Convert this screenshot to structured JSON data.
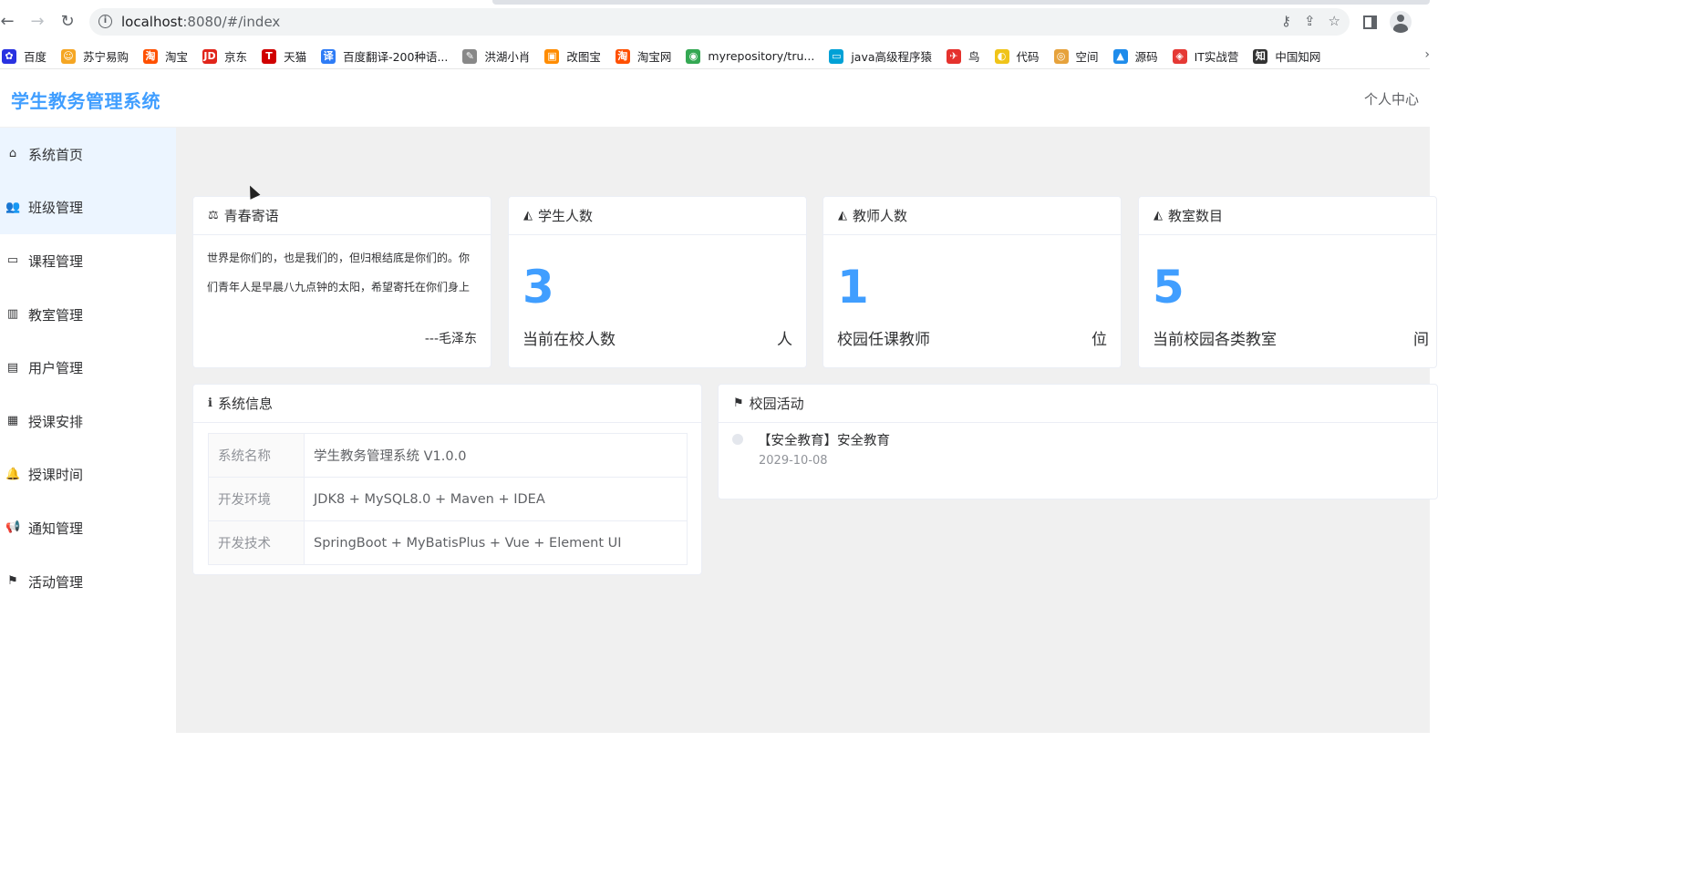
{
  "browser": {
    "url_host": "localhost",
    "url_path": ":8080/#/index",
    "bookmarks": [
      {
        "label": "百度",
        "icon": "baidu-icon",
        "color": "#2932e1",
        "glyph": "✿"
      },
      {
        "label": "苏宁易购",
        "icon": "suning-icon",
        "color": "#f5a623",
        "glyph": "☺"
      },
      {
        "label": "淘宝",
        "icon": "taobao-icon",
        "color": "#ff5000",
        "glyph": "淘"
      },
      {
        "label": "京东",
        "icon": "jd-icon",
        "color": "#e1251b",
        "glyph": "JD"
      },
      {
        "label": "天猫",
        "icon": "tmall-icon",
        "color": "#d00000",
        "glyph": "T"
      },
      {
        "label": "百度翻译-200种语...",
        "icon": "translate-icon",
        "color": "#2e7cf6",
        "glyph": "译"
      },
      {
        "label": "洪湖小肖",
        "icon": "hhxx-icon",
        "color": "#888888",
        "glyph": "✎"
      },
      {
        "label": "改图宝",
        "icon": "gaitubao-icon",
        "color": "#ff8c00",
        "glyph": "▣"
      },
      {
        "label": "淘宝网",
        "icon": "taobaowang-icon",
        "color": "#ff5000",
        "glyph": "淘"
      },
      {
        "label": "myrepository/tru...",
        "icon": "chrome-icon",
        "color": "#34a853",
        "glyph": "◉"
      },
      {
        "label": "java高级程序猿",
        "icon": "bilibili-icon",
        "color": "#00a1d6",
        "glyph": "▭"
      },
      {
        "label": "鸟",
        "icon": "bird-icon",
        "color": "#e5322d",
        "glyph": "✈"
      },
      {
        "label": "代码",
        "icon": "code-icon",
        "color": "#f0c419",
        "glyph": "◐"
      },
      {
        "label": "空间",
        "icon": "qzone-icon",
        "color": "#e6a23c",
        "glyph": "◎"
      },
      {
        "label": "源码",
        "icon": "yuanma-icon",
        "color": "#1f8ceb",
        "glyph": "▲"
      },
      {
        "label": "IT实战营",
        "icon": "it-icon",
        "color": "#e53935",
        "glyph": "◈"
      },
      {
        "label": "中国知网",
        "icon": "cnki-icon",
        "color": "#333333",
        "glyph": "知"
      }
    ]
  },
  "header": {
    "title": "学生教务管理系统",
    "personal": "个人中心"
  },
  "sidebar": {
    "items": [
      {
        "label": "系统首页",
        "icon": "home-icon",
        "glyph": "⌂"
      },
      {
        "label": "班级管理",
        "icon": "users-icon",
        "glyph": "👥"
      },
      {
        "label": "课程管理",
        "icon": "calendar-blank-icon",
        "glyph": "▭"
      },
      {
        "label": "教室管理",
        "icon": "building-icon",
        "glyph": "▥"
      },
      {
        "label": "用户管理",
        "icon": "id-card-icon",
        "glyph": "▤"
      },
      {
        "label": "授课安排",
        "icon": "calendar-icon",
        "glyph": "▦"
      },
      {
        "label": "授课时间",
        "icon": "bell-icon",
        "glyph": "🔔"
      },
      {
        "label": "通知管理",
        "icon": "bullhorn-icon",
        "glyph": "📢"
      },
      {
        "label": "活动管理",
        "icon": "flag-icon",
        "glyph": "⚑"
      }
    ]
  },
  "quote_card": {
    "title": "青春寄语",
    "icon": "balance-scale-icon",
    "text": "世界是你们的，也是我们的，但归根结底是你们的。你们青年人是早晨八九点钟的太阳，希望寄托在你们身上",
    "author": "---毛泽东"
  },
  "stats": [
    {
      "title": "学生人数",
      "icon": "area-chart-icon",
      "value": "3",
      "desc": "当前在校人数",
      "unit": "人"
    },
    {
      "title": "教师人数",
      "icon": "area-chart-icon",
      "value": "1",
      "desc": "校园任课教师",
      "unit": "位"
    },
    {
      "title": "教室数目",
      "icon": "area-chart-icon",
      "value": "5",
      "desc": "当前校园各类教室",
      "unit": "间"
    }
  ],
  "system_info": {
    "title": "系统信息",
    "icon": "info-circle-icon",
    "rows": [
      {
        "key": "系统名称",
        "value": "学生教务管理系统 V1.0.0"
      },
      {
        "key": "开发环境",
        "value": "JDK8 + MySQL8.0 + Maven + IDEA"
      },
      {
        "key": "开发技术",
        "value": "SpringBoot + MyBatisPlus + Vue + Element UI"
      }
    ]
  },
  "activities": {
    "title": "校园活动",
    "icon": "flag-icon",
    "items": [
      {
        "title": "【安全教育】安全教育",
        "time": "2029-10-08"
      }
    ]
  },
  "colors": {
    "primary": "#409eff",
    "menu_active_bg": "#ecf5ff",
    "content_bg": "#f0f0f0"
  }
}
